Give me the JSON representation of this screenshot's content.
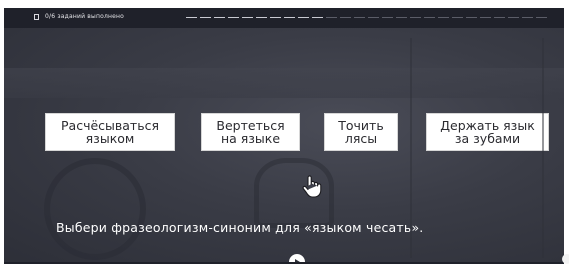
{
  "status": {
    "text": "0/6 заданий выполнено",
    "icon": "task-icon"
  },
  "progress": {
    "completed": 0,
    "total": 6,
    "icon": "progress-segments"
  },
  "answers": [
    {
      "label_line1": "Расчёсываться",
      "label_line2": "языком"
    },
    {
      "label_line1": "Вертеться",
      "label_line2": "на языке"
    },
    {
      "label_line1": "Точить",
      "label_line2": "лясы"
    },
    {
      "label_line1": "Держать язык",
      "label_line2": "за зубами"
    }
  ],
  "question": "Выбери фразеологизм-синоним для «языком чесать».",
  "controls": {
    "play_icon": "play-icon",
    "cursor_icon": "pointer-hand-icon"
  },
  "colors": {
    "background": "#3a3c46",
    "topbar": "#1f212a",
    "answer_bg": "#ffffff",
    "text_light": "#ffffff"
  }
}
